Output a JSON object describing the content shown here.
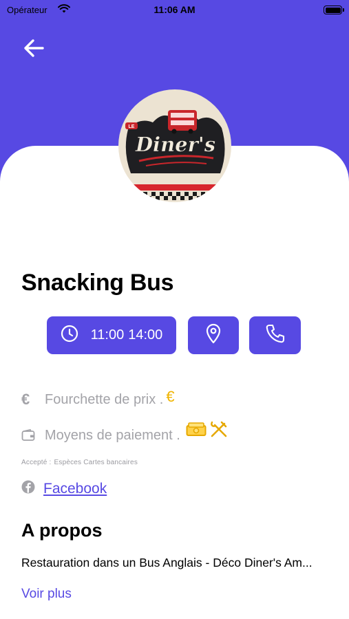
{
  "status_bar": {
    "carrier": "Opérateur",
    "time": "11:06 AM"
  },
  "restaurant": {
    "name": "Snacking Bus",
    "logo_text": "Diner's",
    "logo_small_text": "LE"
  },
  "actions": {
    "hours_open": "11:00",
    "hours_close": "14:00"
  },
  "info": {
    "price_label": "Fourchette de prix .",
    "price_symbol": "€",
    "payment_label": "Moyens de paiement .",
    "accepted_prefix": "Accepté :",
    "accepted_methods": "Espèces Cartes bancaires",
    "facebook_label": "Facebook"
  },
  "about": {
    "title": "A propos",
    "text": "Restauration dans un Bus Anglais - Déco Diner's Am...",
    "more_label": "Voir plus"
  },
  "colors": {
    "accent": "#5749E3",
    "gold": "#F0B400",
    "muted": "#A3A3A8"
  }
}
